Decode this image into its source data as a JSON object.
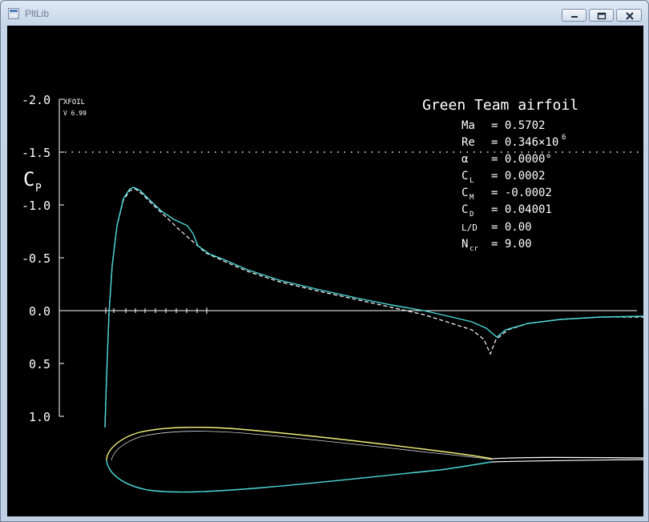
{
  "window": {
    "title": "PltLib",
    "icon": "pltlib-app-icon",
    "controls": [
      "minimize-icon",
      "maximize-icon",
      "close-icon"
    ]
  },
  "plot": {
    "program": "XFOIL",
    "version": "V 6.99",
    "y_axis_symbol": "C",
    "y_axis_subscript": "P",
    "y_ticks": [
      "-2.0",
      "-1.5",
      "-1.0",
      "-0.5",
      "0.0",
      "0.5",
      "1.0"
    ],
    "colors": {
      "background": "#000000",
      "inviscid_cp": "#ffffff",
      "viscous_cp": "#4dd9d9",
      "upper_surface": "#f0f07a",
      "lower_surface": "#4dd9d9"
    }
  },
  "info": {
    "title": "Green Team airfoil",
    "mach": {
      "label": "Ma",
      "value": "= 0.5702"
    },
    "reynolds": {
      "label": "Re",
      "value": "= 0.346×10",
      "exponent": "6"
    },
    "alpha": {
      "label": "α",
      "value": "= 0.0000°"
    },
    "cl": {
      "label": "C",
      "sub": "L",
      "value": "= 0.0002"
    },
    "cm": {
      "label": "C",
      "sub": "M",
      "value": "= -0.0002"
    },
    "cd": {
      "label": "C",
      "sub": "D",
      "value": "= 0.04001"
    },
    "ld": {
      "label": "L/D",
      "value": "= 0.00"
    },
    "ncr": {
      "label": "N",
      "sub": "cr",
      "value": "= 9.00"
    }
  },
  "chart_data": {
    "type": "line",
    "title": "Green Team airfoil",
    "ylabel": "Cp",
    "ylim": [
      1.0,
      -2.0
    ],
    "y_inverted": true,
    "reference_line_dotted": -1.5,
    "x": [
      0.0,
      0.005,
      0.02,
      0.04,
      0.07,
      0.1,
      0.15,
      0.2,
      0.3,
      0.4,
      0.5,
      0.6,
      0.7,
      0.75,
      0.8,
      0.85,
      0.9,
      1.0,
      1.1,
      1.3
    ],
    "series": [
      {
        "values": [
          1.05,
          0.0,
          -0.9,
          -1.15,
          -1.1,
          -0.95,
          -0.75,
          -0.55,
          -0.42,
          -0.3,
          -0.22,
          -0.12,
          0.0,
          0.08,
          0.2,
          0.18,
          0.12,
          0.09,
          0.07,
          0.06
        ]
      },
      {
        "values": [
          1.1,
          0.0,
          -0.95,
          -1.16,
          -1.1,
          -0.95,
          -0.8,
          -0.58,
          -0.43,
          -0.31,
          -0.23,
          -0.13,
          0.0,
          0.06,
          0.12,
          0.25,
          0.14,
          0.1,
          0.07,
          0.06
        ]
      }
    ]
  }
}
